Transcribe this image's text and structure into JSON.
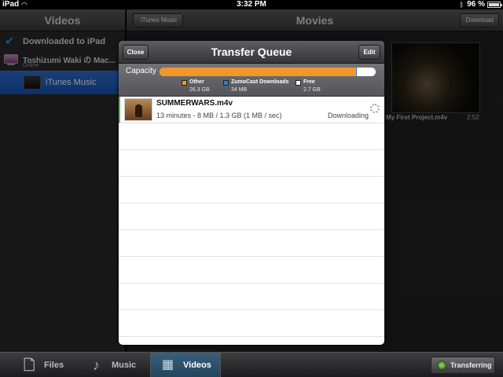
{
  "status_bar": {
    "carrier": "iPad",
    "wifi_icon": "wifi-icon",
    "time": "3:32 PM",
    "bluetooth_icon": "bluetooth-icon",
    "battery_percent": "96 %"
  },
  "sidebar": {
    "title": "Videos",
    "items": [
      {
        "label": "Downloaded to iPad",
        "icon": "checkmark-icon"
      },
      {
        "label": "Toshizumi Waki の Mac...",
        "sublabel": "Online",
        "icon": "mac-icon"
      },
      {
        "label": "iTunes Music",
        "icon": "movie-thumbnail",
        "selected": true
      }
    ]
  },
  "main": {
    "back_button": "iTunes Music",
    "title": "Movies",
    "download_button": "Download",
    "movie": {
      "title": "My First Project.m4v",
      "duration": "2:52"
    }
  },
  "tab_bar": {
    "tabs": [
      {
        "label": "Files",
        "icon": "file-icon"
      },
      {
        "label": "Music",
        "icon": "music-note-icon"
      },
      {
        "label": "Videos",
        "icon": "film-icon",
        "selected": true
      }
    ],
    "transfer_button": "Transferring"
  },
  "modal": {
    "title": "Transfer Queue",
    "close_label": "Close",
    "edit_label": "Edit",
    "capacity": {
      "label": "Capacity",
      "used_fraction_other": 0.91,
      "used_fraction_zumo": 0.002,
      "legend": [
        {
          "name": "Other",
          "size": "26.3 GB",
          "color": "#f0962a"
        },
        {
          "name": "ZumoCast Downloads",
          "size": "34 MB",
          "color": "#2d7fd8"
        },
        {
          "name": "Free",
          "size": "2.7 GB",
          "color": "#ffffff"
        }
      ]
    },
    "queue": [
      {
        "filename": "SUMMERWARS.m4v",
        "details": "13 minutes - 8 MB / 1.3 GB (1 MB / sec)",
        "status": "Downloading"
      }
    ]
  },
  "colors": {
    "accent_blue": "#1554b8",
    "other_orange": "#f0962a",
    "zumo_blue": "#2d7fd8",
    "transfer_green": "#4a8a2a"
  }
}
